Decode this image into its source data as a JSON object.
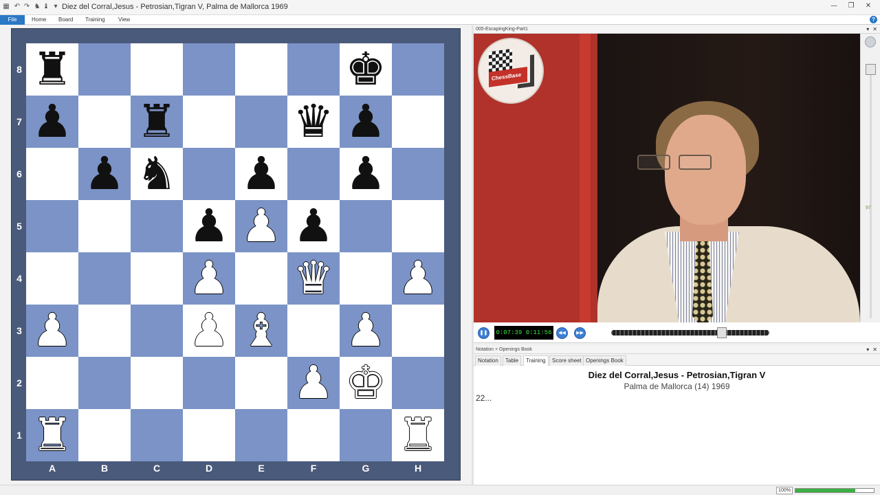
{
  "window": {
    "title": "Diez del Corral,Jesus - Petrosian,Tigran V, Palma de Mallorca 1969",
    "min": "—",
    "max": "❐",
    "close": "✕"
  },
  "menu": [
    "File",
    "Home",
    "Board",
    "Training",
    "View"
  ],
  "help": "?",
  "board": {
    "ranks": [
      "8",
      "7",
      "6",
      "5",
      "4",
      "3",
      "2",
      "1"
    ],
    "files": [
      "A",
      "B",
      "C",
      "D",
      "E",
      "F",
      "G",
      "H"
    ],
    "pieces": [
      {
        "sq": "a8",
        "p": "r"
      },
      {
        "sq": "g8",
        "p": "k"
      },
      {
        "sq": "a7",
        "p": "p"
      },
      {
        "sq": "c7",
        "p": "r"
      },
      {
        "sq": "f7",
        "p": "q"
      },
      {
        "sq": "g7",
        "p": "p"
      },
      {
        "sq": "b6",
        "p": "p"
      },
      {
        "sq": "c6",
        "p": "n"
      },
      {
        "sq": "e6",
        "p": "p"
      },
      {
        "sq": "g6",
        "p": "p"
      },
      {
        "sq": "d5",
        "p": "p"
      },
      {
        "sq": "e5",
        "p": "P"
      },
      {
        "sq": "f5",
        "p": "p"
      },
      {
        "sq": "d4",
        "p": "P"
      },
      {
        "sq": "f4",
        "p": "Q"
      },
      {
        "sq": "h4",
        "p": "P"
      },
      {
        "sq": "a3",
        "p": "P"
      },
      {
        "sq": "d3",
        "p": "P"
      },
      {
        "sq": "e3",
        "p": "B"
      },
      {
        "sq": "g3",
        "p": "P"
      },
      {
        "sq": "f2",
        "p": "P"
      },
      {
        "sq": "g2",
        "p": "K"
      },
      {
        "sq": "a1",
        "p": "R"
      },
      {
        "sq": "h1",
        "p": "R"
      }
    ]
  },
  "video": {
    "title": "005-EscapingKing-Part1",
    "logo_text": "ChessBase",
    "time": "0:07:39 0:11:56",
    "volume": "97",
    "seek_fraction": 0.7
  },
  "notation": {
    "header": "Notation + Openings Book",
    "tabs": [
      "Notation",
      "Table",
      "Training",
      "Score sheet",
      "Openings Book"
    ],
    "active_tab": 2,
    "game_title": "Diez del Corral,Jesus - Petrosian,Tigran V",
    "game_event": "Palma de Mallorca (14) 1969",
    "moves": "22..."
  },
  "status": {
    "zoom": "100%",
    "zoom_fraction": 0.76
  }
}
